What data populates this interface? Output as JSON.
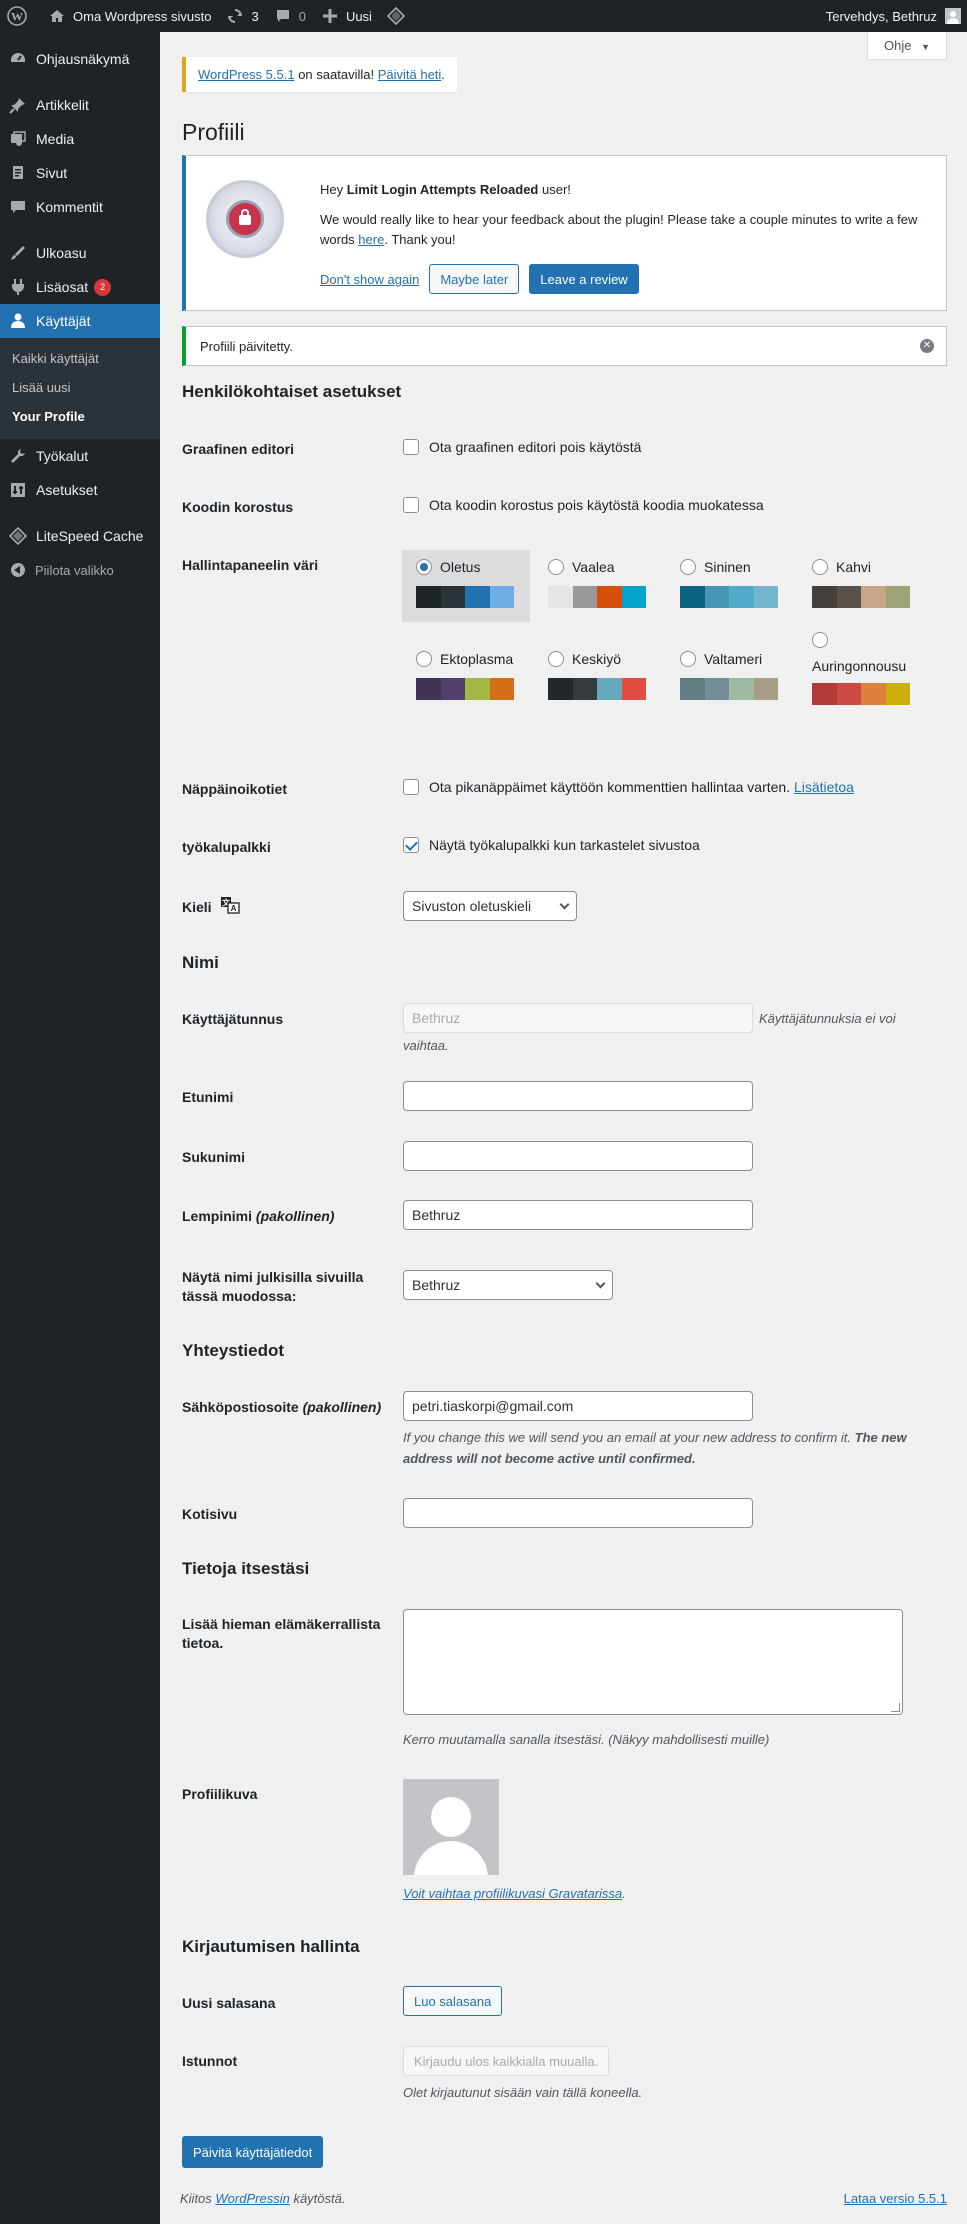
{
  "adminbar": {
    "site_name": "Oma Wordpress sivusto",
    "updates_count": "3",
    "comments_count": "0",
    "new_label": "Uusi",
    "greeting": "Tervehdys, Bethruz"
  },
  "sidebar": {
    "items": [
      {
        "label": "Ohjausnäkymä",
        "icon": "dashboard-icon"
      },
      {
        "label": "Artikkelit",
        "icon": "pin-icon"
      },
      {
        "label": "Media",
        "icon": "media-icon"
      },
      {
        "label": "Sivut",
        "icon": "pages-icon"
      },
      {
        "label": "Kommentit",
        "icon": "comments-icon"
      },
      {
        "label": "Ulkoasu",
        "icon": "appearance-icon"
      },
      {
        "label": "Lisäosat",
        "icon": "plugins-icon",
        "badge": "2"
      },
      {
        "label": "Käyttäjät",
        "icon": "users-icon"
      },
      {
        "label": "Työkalut",
        "icon": "tools-icon"
      },
      {
        "label": "Asetukset",
        "icon": "settings-icon"
      },
      {
        "label": "LiteSpeed Cache",
        "icon": "litespeed-icon"
      }
    ],
    "submenu": [
      "Kaikki käyttäjät",
      "Lisää uusi",
      "Your Profile"
    ],
    "collapse_label": "Piilota valikko"
  },
  "help_tab": "Ohje",
  "update_nag": {
    "link": "WordPress 5.5.1",
    "middle": " on saatavilla! ",
    "action": "Päivitä heti",
    "end": "."
  },
  "page_title": "Profiili",
  "llar_notice": {
    "hey": "Hey ",
    "plugin": "Limit Login Attempts Reloaded",
    "user": " user!",
    "body": "We would really like to hear your feedback about the plugin! Please take a couple minutes to write a few words ",
    "here": "here",
    "thanks": ". Thank you!",
    "dont_show": "Don't show again",
    "maybe_later": "Maybe later",
    "leave_review": "Leave a review"
  },
  "success_notice": "Profiili päivitetty.",
  "personal": {
    "heading": "Henkilökohtaiset asetukset",
    "visual_editor_label": "Graafinen editori",
    "visual_editor_text": "Ota graafinen editori pois käytöstä",
    "syntax_label": "Koodin korostus",
    "syntax_text": "Ota koodin korostus pois käytöstä koodia muokatessa",
    "color_label": "Hallintapaneelin väri",
    "schemes": [
      {
        "name": "Oletus",
        "colors": [
          "#1d2327",
          "#2c3338",
          "#2271b1",
          "#72aee6"
        ],
        "selected": true
      },
      {
        "name": "Vaalea",
        "colors": [
          "#e5e5e5",
          "#999999",
          "#d64e07",
          "#04a4cc"
        ]
      },
      {
        "name": "Sininen",
        "colors": [
          "#096484",
          "#4796b3",
          "#52accc",
          "#74b6ce"
        ]
      },
      {
        "name": "Kahvi",
        "colors": [
          "#46403c",
          "#59524c",
          "#c7a589",
          "#9ea476"
        ]
      },
      {
        "name": "Ektoplasma",
        "colors": [
          "#413256",
          "#523f6d",
          "#a3b745",
          "#d46f15"
        ]
      },
      {
        "name": "Keskiyö",
        "colors": [
          "#25282b",
          "#363b3f",
          "#69a8bb",
          "#e14d43"
        ]
      },
      {
        "name": "Valtameri",
        "colors": [
          "#627c83",
          "#738e96",
          "#9ebaa0",
          "#aa9d88"
        ]
      },
      {
        "name": "Auringonnousu",
        "colors": [
          "#b43c38",
          "#cf4944",
          "#dd823b",
          "#ccaf0b"
        ]
      }
    ],
    "shortcuts_label": "Näppäinoikotiet",
    "shortcuts_text": "Ota pikanäppäimet käyttöön kommenttien hallintaa varten. ",
    "shortcuts_link": "Lisätietoa",
    "toolbar_label": "työkalupalkki",
    "toolbar_text": "Näytä työkalupalkki kun tarkastelet sivustoa",
    "language_label": "Kieli",
    "language_value": "Sivuston oletuskieli"
  },
  "name": {
    "heading": "Nimi",
    "username_label": "Käyttäjätunnus",
    "username_value": "Bethruz",
    "username_note": "Käyttäjätunnuksia ei voi vaihtaa.",
    "first_label": "Etunimi",
    "first_value": "",
    "last_label": "Sukunimi",
    "last_value": "",
    "nickname_label": "Lempinimi",
    "nickname_req": "(pakollinen)",
    "nickname_value": "Bethruz",
    "display_label": "Näytä nimi julkisilla sivuilla tässä muodossa:",
    "display_value": "Bethruz"
  },
  "contact": {
    "heading": "Yhteystiedot",
    "email_label": "Sähköpostiosoite",
    "email_req": "(pakollinen)",
    "email_value": "petri.tiaskorpi@gmail.com",
    "email_note_1": "If you change this we will send you an email at your new address to confirm it. ",
    "email_note_2": "The new address will not become active until confirmed.",
    "website_label": "Kotisivu",
    "website_value": ""
  },
  "about": {
    "heading": "Tietoja itsestäsi",
    "bio_label": "Lisää hieman elämäkerrallista tietoa.",
    "bio_note": "Kerro muutamalla sanalla itsestäsi. (Näkyy mahdollisesti muille)",
    "picture_label": "Profiilikuva",
    "picture_link": "Voit vaihtaa profiilikuvasi Gravatarissa",
    "picture_link_end": "."
  },
  "account": {
    "heading": "Kirjautumisen hallinta",
    "password_label": "Uusi salasana",
    "password_button": "Luo salasana",
    "sessions_label": "Istunnot",
    "sessions_button": "Kirjaudu ulos kaikkialla muualla.",
    "sessions_note": "Olet kirjautunut sisään vain tällä koneella."
  },
  "submit_label": "Päivitä käyttäjätiedot",
  "footer": {
    "thanks_pre": "Kiitos ",
    "thanks_link": "WordPressin",
    "thanks_post": " käytöstä.",
    "version_link": "Lataa versio 5.5.1"
  }
}
